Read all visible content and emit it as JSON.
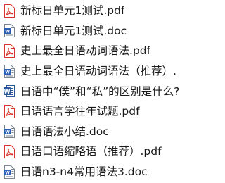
{
  "files": [
    {
      "name": "新标日单元1测试.pdf",
      "icon": "pdf-file-icon"
    },
    {
      "name": "新标日单元1测试.doc",
      "icon": "doc-file-icon"
    },
    {
      "name": "史上最全日语动词语法.pdf",
      "icon": "pdf-file-icon"
    },
    {
      "name": "史上最全日语动词语法（推荐）.",
      "icon": "doc-file-icon"
    },
    {
      "name": "日语中“僕”和“私”的区别是什么?",
      "icon": "word-file-icon"
    },
    {
      "name": "日语语言学往年试题.pdf",
      "icon": "pdf-file-icon"
    },
    {
      "name": "日语语法小结.doc",
      "icon": "doc-file-icon"
    },
    {
      "name": "日语口语缩略语（推荐）.pdf",
      "icon": "pdf-file-icon"
    },
    {
      "name": "日语n3-n4常用语法3.doc",
      "icon": "doc-file-icon"
    }
  ],
  "colors": {
    "pdf_accent": "#d9342b",
    "doc_accent": "#2b5fb3",
    "word_accent": "#2b579a"
  }
}
